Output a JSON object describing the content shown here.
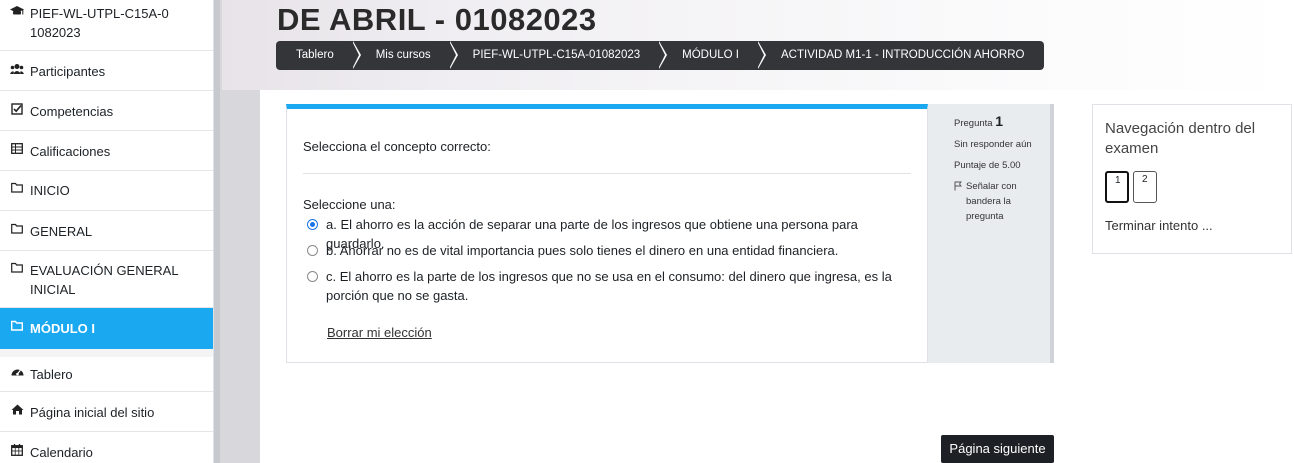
{
  "sidebar": {
    "items": [
      {
        "icon": "graduation-cap-icon",
        "label": "PIEF-WL-UTPL-C15A-01082023"
      },
      {
        "icon": "users-icon",
        "label": "Participantes"
      },
      {
        "icon": "check-square-icon",
        "label": "Competencias"
      },
      {
        "icon": "table-icon",
        "label": "Calificaciones"
      },
      {
        "icon": "folder-icon",
        "label": "INICIO"
      },
      {
        "icon": "folder-icon",
        "label": "GENERAL"
      },
      {
        "icon": "folder-icon",
        "label": "EVALUACIÓN GENERAL INICIAL"
      },
      {
        "icon": "folder-icon",
        "label": "MÓDULO I"
      },
      {
        "icon": "dashboard-icon",
        "label": "Tablero"
      },
      {
        "icon": "home-icon",
        "label": "Página inicial del sitio"
      },
      {
        "icon": "calendar-icon",
        "label": "Calendario"
      }
    ]
  },
  "header": {
    "title": "DE ABRIL - 01082023",
    "breadcrumb": [
      "Tablero",
      "Mis cursos",
      "PIEF-WL-UTPL-C15A-01082023",
      "MÓDULO I",
      "ACTIVIDAD M1-1 - INTRODUCCIÓN AHORRO"
    ]
  },
  "question": {
    "prompt": "Selecciona el concepto correcto:",
    "select_label": "Seleccione una:",
    "options": [
      {
        "text": "a. El ahorro es la acción de separar una parte de los ingresos que obtiene una persona para guardarlo.",
        "selected": true
      },
      {
        "text": "b. Ahorrar no es de vital importancia pues solo tienes el dinero en una entidad financiera.",
        "selected": false
      },
      {
        "text": "c. El ahorro es la parte de los ingresos que no se usa en el consumo: del dinero que ingresa, es la porción que no se gasta.",
        "selected": false
      }
    ],
    "clear_label": "Borrar mi elección"
  },
  "question_info": {
    "label": "Pregunta",
    "number": "1",
    "status": "Sin responder aún",
    "score": "Puntaje de 5.00",
    "flag_label": "Señalar con bandera la pregunta"
  },
  "quiz_nav": {
    "title": "Navegación dentro del examen",
    "buttons": [
      "1",
      "2"
    ],
    "finish_label": "Terminar intento ..."
  },
  "footer": {
    "next_label": "Página siguiente"
  },
  "colors": {
    "accent": "#1aa8f0",
    "dark": "#1d2125"
  }
}
